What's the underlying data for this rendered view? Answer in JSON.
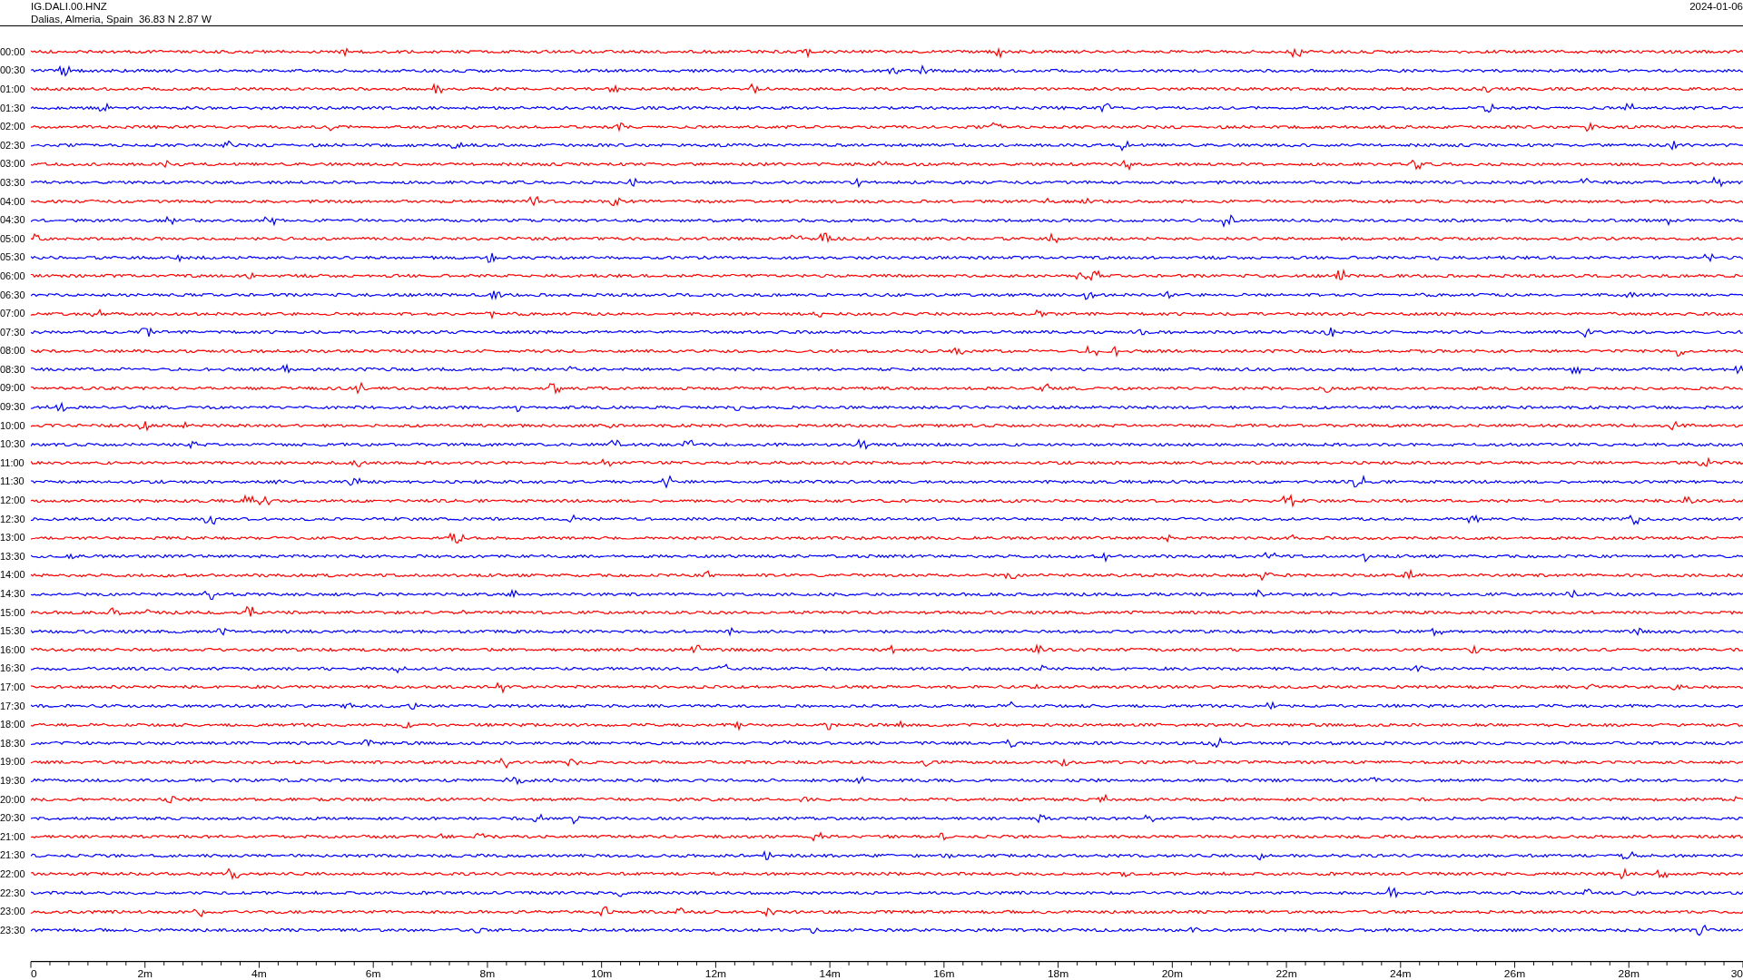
{
  "header": {
    "station": "IG.DALI.00.HNZ",
    "location": "Dalias, Almeria, Spain  36.83 N 2.87 W",
    "date": "2024-01-06"
  },
  "rows": [
    {
      "time": "00:00",
      "color": "#ff0000"
    },
    {
      "time": "00:30",
      "color": "#0000ff"
    },
    {
      "time": "01:00",
      "color": "#ff0000"
    },
    {
      "time": "01:30",
      "color": "#0000ff"
    },
    {
      "time": "02:00",
      "color": "#ff0000"
    },
    {
      "time": "02:30",
      "color": "#0000ff"
    },
    {
      "time": "03:00",
      "color": "#ff0000"
    },
    {
      "time": "03:30",
      "color": "#0000ff"
    },
    {
      "time": "04:00",
      "color": "#ff0000"
    },
    {
      "time": "04:30",
      "color": "#0000ff"
    },
    {
      "time": "05:00",
      "color": "#ff0000"
    },
    {
      "time": "05:30",
      "color": "#0000ff"
    },
    {
      "time": "06:00",
      "color": "#ff0000"
    },
    {
      "time": "06:30",
      "color": "#0000ff"
    },
    {
      "time": "07:00",
      "color": "#ff0000"
    },
    {
      "time": "07:30",
      "color": "#0000ff"
    },
    {
      "time": "08:00",
      "color": "#ff0000"
    },
    {
      "time": "08:30",
      "color": "#0000ff"
    },
    {
      "time": "09:00",
      "color": "#ff0000"
    },
    {
      "time": "09:30",
      "color": "#0000ff"
    },
    {
      "time": "10:00",
      "color": "#ff0000"
    },
    {
      "time": "10:30",
      "color": "#0000ff"
    },
    {
      "time": "11:00",
      "color": "#ff0000"
    },
    {
      "time": "11:30",
      "color": "#0000ff"
    },
    {
      "time": "12:00",
      "color": "#ff0000"
    },
    {
      "time": "12:30",
      "color": "#0000ff"
    },
    {
      "time": "13:00",
      "color": "#ff0000"
    },
    {
      "time": "13:30",
      "color": "#0000ff"
    },
    {
      "time": "14:00",
      "color": "#ff0000"
    },
    {
      "time": "14:30",
      "color": "#0000ff"
    },
    {
      "time": "15:00",
      "color": "#ff0000"
    },
    {
      "time": "15:30",
      "color": "#0000ff"
    },
    {
      "time": "16:00",
      "color": "#ff0000"
    },
    {
      "time": "16:30",
      "color": "#0000ff"
    },
    {
      "time": "17:00",
      "color": "#ff0000"
    },
    {
      "time": "17:30",
      "color": "#0000ff"
    },
    {
      "time": "18:00",
      "color": "#ff0000"
    },
    {
      "time": "18:30",
      "color": "#0000ff"
    },
    {
      "time": "19:00",
      "color": "#ff0000"
    },
    {
      "time": "19:30",
      "color": "#0000ff"
    },
    {
      "time": "20:00",
      "color": "#ff0000"
    },
    {
      "time": "20:30",
      "color": "#0000ff"
    },
    {
      "time": "21:00",
      "color": "#ff0000"
    },
    {
      "time": "21:30",
      "color": "#0000ff"
    },
    {
      "time": "22:00",
      "color": "#ff0000"
    },
    {
      "time": "22:30",
      "color": "#0000ff"
    },
    {
      "time": "23:00",
      "color": "#ff0000"
    },
    {
      "time": "23:30",
      "color": "#0000ff"
    }
  ],
  "time_axis": {
    "labels": [
      "0",
      "2m",
      "4m",
      "6m",
      "8m",
      "10m",
      "12m",
      "14m",
      "16m",
      "18m",
      "20m",
      "22m",
      "24m",
      "26m",
      "28m",
      "30"
    ]
  }
}
